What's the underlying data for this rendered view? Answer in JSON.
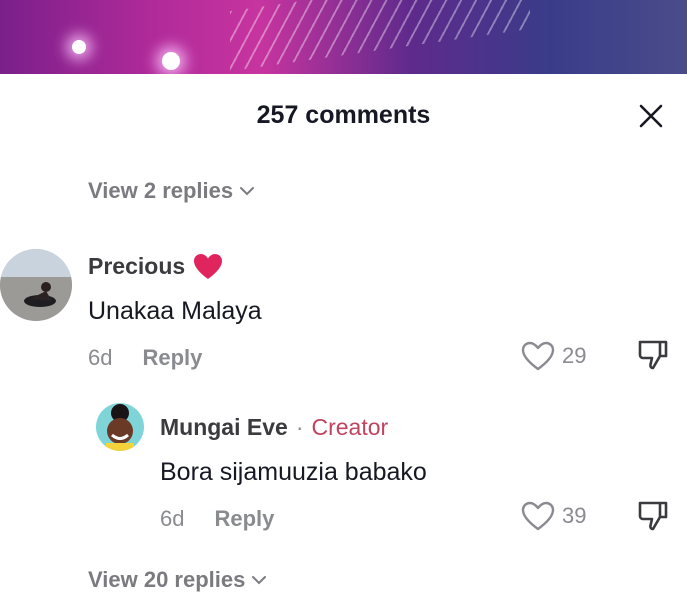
{
  "header": {
    "title": "257 comments"
  },
  "top_thread": {
    "view_replies_label": "View 2 replies"
  },
  "comments": [
    {
      "username": "Precious",
      "text": "Unakaa Malaya",
      "age": "6d",
      "reply_label": "Reply",
      "likes": "29"
    }
  ],
  "reply": {
    "username": "Mungai Eve",
    "separator": "·",
    "badge": "Creator",
    "text": "Bora sijamuuzia babako",
    "age": "6d",
    "reply_label": "Reply",
    "likes": "39"
  },
  "footer_thread": {
    "view_replies_label": "View 20 replies"
  },
  "colors": {
    "creator_badge": "#c0445f",
    "heart_emoji": "#e0245e",
    "text_primary": "#161823",
    "text_secondary": "#8a8b91"
  }
}
